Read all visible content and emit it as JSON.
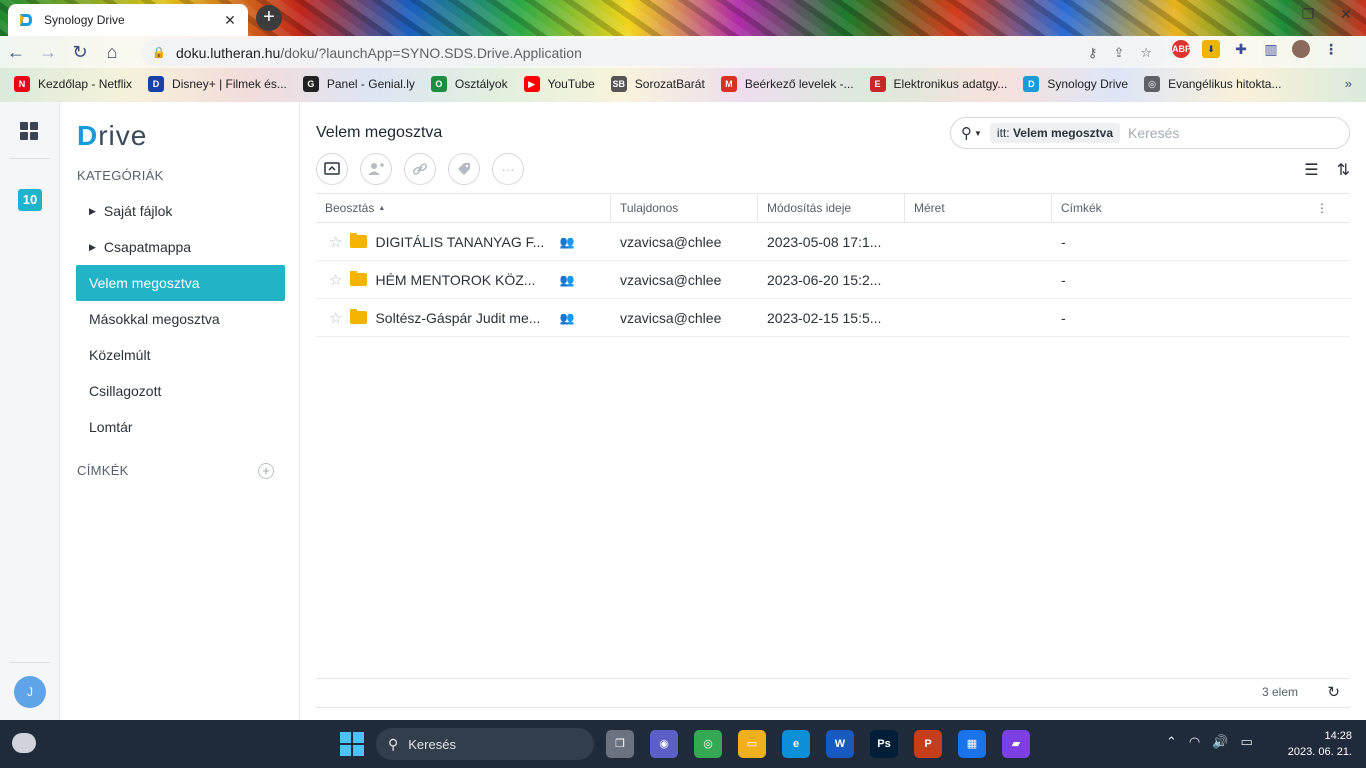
{
  "browser": {
    "tab_title": "Synology Drive",
    "tab_close": "✕",
    "new_tab": "+",
    "url_host": "doku.lutheran.hu",
    "url_path": "/doku/?launchApp=SYNO.SDS.Drive.Application",
    "bookmarks": [
      {
        "label": "Kezdőlap - Netflix",
        "icon": "netflix-icon",
        "color": "#e50914",
        "glyph": "N"
      },
      {
        "label": "Disney+ | Filmek és...",
        "icon": "disney-icon",
        "color": "#1a3fa8",
        "glyph": "D"
      },
      {
        "label": "Panel - Genial.ly",
        "icon": "genially-icon",
        "color": "#222222",
        "glyph": "G"
      },
      {
        "label": "Osztályok",
        "icon": "classroom-icon",
        "color": "#1e8e3e",
        "glyph": "O"
      },
      {
        "label": "YouTube",
        "icon": "youtube-icon",
        "color": "#ff0000",
        "glyph": "▶"
      },
      {
        "label": "SorozatBarát",
        "icon": "sorozatbarat-icon",
        "color": "#555555",
        "glyph": "SB"
      },
      {
        "label": "Beérkező levelek -...",
        "icon": "gmail-icon",
        "color": "#d93025",
        "glyph": "M"
      },
      {
        "label": "Elektronikus adatgy...",
        "icon": "kreta-icon",
        "color": "#c62828",
        "glyph": "E"
      },
      {
        "label": "Synology Drive",
        "icon": "synology-drive-icon",
        "color": "#1a9bd7",
        "glyph": "D"
      },
      {
        "label": "Evangélikus hitokta...",
        "icon": "globe-icon",
        "color": "#5f6368",
        "glyph": "◎"
      }
    ],
    "bookmarks_more": "»"
  },
  "rail": {
    "badge": "10",
    "avatar": "J"
  },
  "sidebar": {
    "logo_d": "D",
    "logo_rest": "rive",
    "categories_title": "KATEGÓRIÁK",
    "items": [
      {
        "label": "Saját fájlok",
        "expandable": true
      },
      {
        "label": "Csapatmappa",
        "expandable": true
      },
      {
        "label": "Velem megosztva",
        "active": true
      },
      {
        "label": "Másokkal megosztva"
      },
      {
        "label": "Közelmúlt"
      },
      {
        "label": "Csillagozott"
      },
      {
        "label": "Lomtár"
      }
    ],
    "tags_title": "CÍMKÉK",
    "add_tag": "+"
  },
  "main": {
    "title": "Velem megosztva",
    "search": {
      "scope_prefix": "itt:",
      "scope_value": "Velem megosztva",
      "placeholder": "Keresés"
    },
    "columns": [
      "Beosztás",
      "Tulajdonos",
      "Módosítás ideje",
      "Méret",
      "Címkék"
    ],
    "rows": [
      {
        "name": "DIGITÁLIS TANANYAG F...",
        "owner": "vzavicsa@chlee",
        "modified": "2023-05-08 17:1...",
        "size": "",
        "tags": "-"
      },
      {
        "name": "HÉM MENTOROK KÖZ...",
        "owner": "vzavicsa@chlee",
        "modified": "2023-06-20 15:2...",
        "size": "",
        "tags": "-"
      },
      {
        "name": "Soltész-Gáspár Judit me...",
        "owner": "vzavicsa@chlee",
        "modified": "2023-02-15 15:5...",
        "size": "",
        "tags": "-"
      }
    ],
    "footer_count": "3 elem"
  },
  "taskbar": {
    "search_label": "Keresés",
    "apps": [
      {
        "name": "taskview-icon",
        "color": "#6b7280",
        "glyph": "❐"
      },
      {
        "name": "teams-chat-icon",
        "color": "#5b5fc7",
        "glyph": "◉"
      },
      {
        "name": "chrome-icon",
        "color": "#34a853",
        "glyph": "◎"
      },
      {
        "name": "file-explorer-icon",
        "color": "#f2b01e",
        "glyph": "▭"
      },
      {
        "name": "edge-icon",
        "color": "#0c8fd6",
        "glyph": "e"
      },
      {
        "name": "word-icon",
        "color": "#185abd",
        "glyph": "W"
      },
      {
        "name": "photoshop-icon",
        "color": "#001e36",
        "glyph": "Ps"
      },
      {
        "name": "powerpoint-icon",
        "color": "#c43e1c",
        "glyph": "P"
      },
      {
        "name": "calendar-icon",
        "color": "#1a73e8",
        "glyph": "▦"
      },
      {
        "name": "clipchamp-icon",
        "color": "#7b3fe4",
        "glyph": "▰"
      }
    ],
    "time": "14:28",
    "date": "2023. 06. 21."
  }
}
